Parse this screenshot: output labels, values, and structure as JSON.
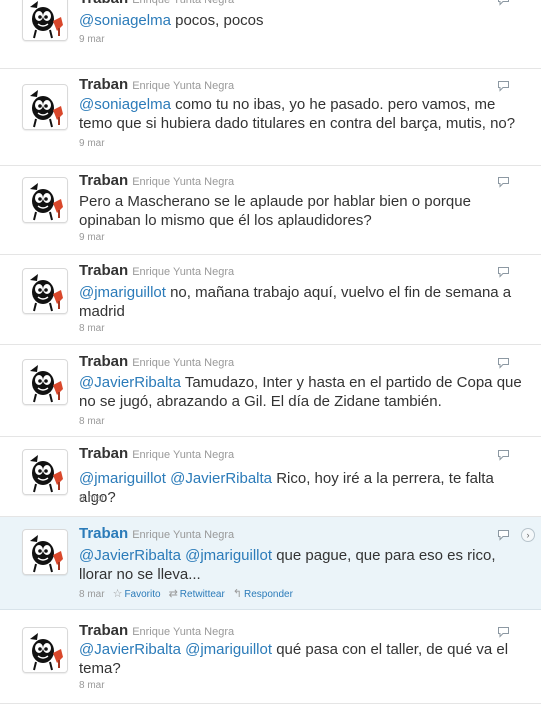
{
  "tweets": [
    {
      "screen_name": "Traban",
      "full_name": "Enrique Yunta Negra",
      "segments": [
        {
          "t": "@soniagelma",
          "m": true
        },
        {
          "t": " pocos, pocos",
          "m": false
        }
      ],
      "time": "9 mar"
    },
    {
      "screen_name": "Traban",
      "full_name": "Enrique Yunta Negra",
      "segments": [
        {
          "t": "@soniagelma",
          "m": true
        },
        {
          "t": " como tu no ibas, yo he pasado. pero vamos, me temo que si hubiera dado titulares en contra del barça, mutis, no?",
          "m": false
        }
      ],
      "time": "9 mar"
    },
    {
      "screen_name": "Traban",
      "full_name": "Enrique Yunta Negra",
      "segments": [
        {
          "t": "Pero a Mascherano se le aplaude por hablar bien o porque opinaban lo mismo que él los aplaudidores?",
          "m": false
        }
      ],
      "time": "9 mar"
    },
    {
      "screen_name": "Traban",
      "full_name": "Enrique Yunta Negra",
      "segments": [
        {
          "t": "@jmariguillot",
          "m": true
        },
        {
          "t": " no, mañana trabajo aquí, vuelvo el fin de semana a madrid",
          "m": false
        }
      ],
      "time": "8 mar"
    },
    {
      "screen_name": "Traban",
      "full_name": "Enrique Yunta Negra",
      "segments": [
        {
          "t": "@JavierRibalta",
          "m": true
        },
        {
          "t": " Tamudazo, Inter y hasta en el partido de Copa que no se jugó, abrazando a Gil. El día de Zidane también.",
          "m": false
        }
      ],
      "time": "8 mar"
    },
    {
      "screen_name": "Traban",
      "full_name": "Enrique Yunta Negra",
      "segments": [
        {
          "t": "@jmariguillot",
          "m": true
        },
        {
          "t": " ",
          "m": false
        },
        {
          "t": "@JavierRibalta",
          "m": true
        },
        {
          "t": " Rico, hoy iré a la perrera, te falta algo?",
          "m": false
        }
      ],
      "time": "8 mar"
    },
    {
      "screen_name": "Traban",
      "full_name": "Enrique Yunta Negra",
      "segments": [
        {
          "t": "@JavierRibalta",
          "m": true
        },
        {
          "t": " ",
          "m": false
        },
        {
          "t": "@jmariguillot",
          "m": true
        },
        {
          "t": " que pague, que para eso es rico, llorar no se lleva...",
          "m": false
        }
      ],
      "time": "8 mar",
      "hover": true,
      "actions": {
        "favorite": "Favorito",
        "retweet": "Retwittear",
        "reply": "Responder"
      }
    },
    {
      "screen_name": "Traban",
      "full_name": "Enrique Yunta Negra",
      "segments": [
        {
          "t": "@JavierRibalta",
          "m": true
        },
        {
          "t": " ",
          "m": false
        },
        {
          "t": "@jmariguillot",
          "m": true
        },
        {
          "t": " qué pasa con el taller, de qué va el tema?",
          "m": false
        }
      ],
      "time": "8 mar"
    }
  ],
  "icons": {
    "reply": "reply-icon",
    "expand": "expand-arrow-icon",
    "favorite": "star-icon",
    "retweet": "retweet-icon",
    "respond": "reply-arrow-icon"
  },
  "colors": {
    "link": "#2b7bb9",
    "hover_bg": "#ebf4f9",
    "muted": "#999999"
  }
}
